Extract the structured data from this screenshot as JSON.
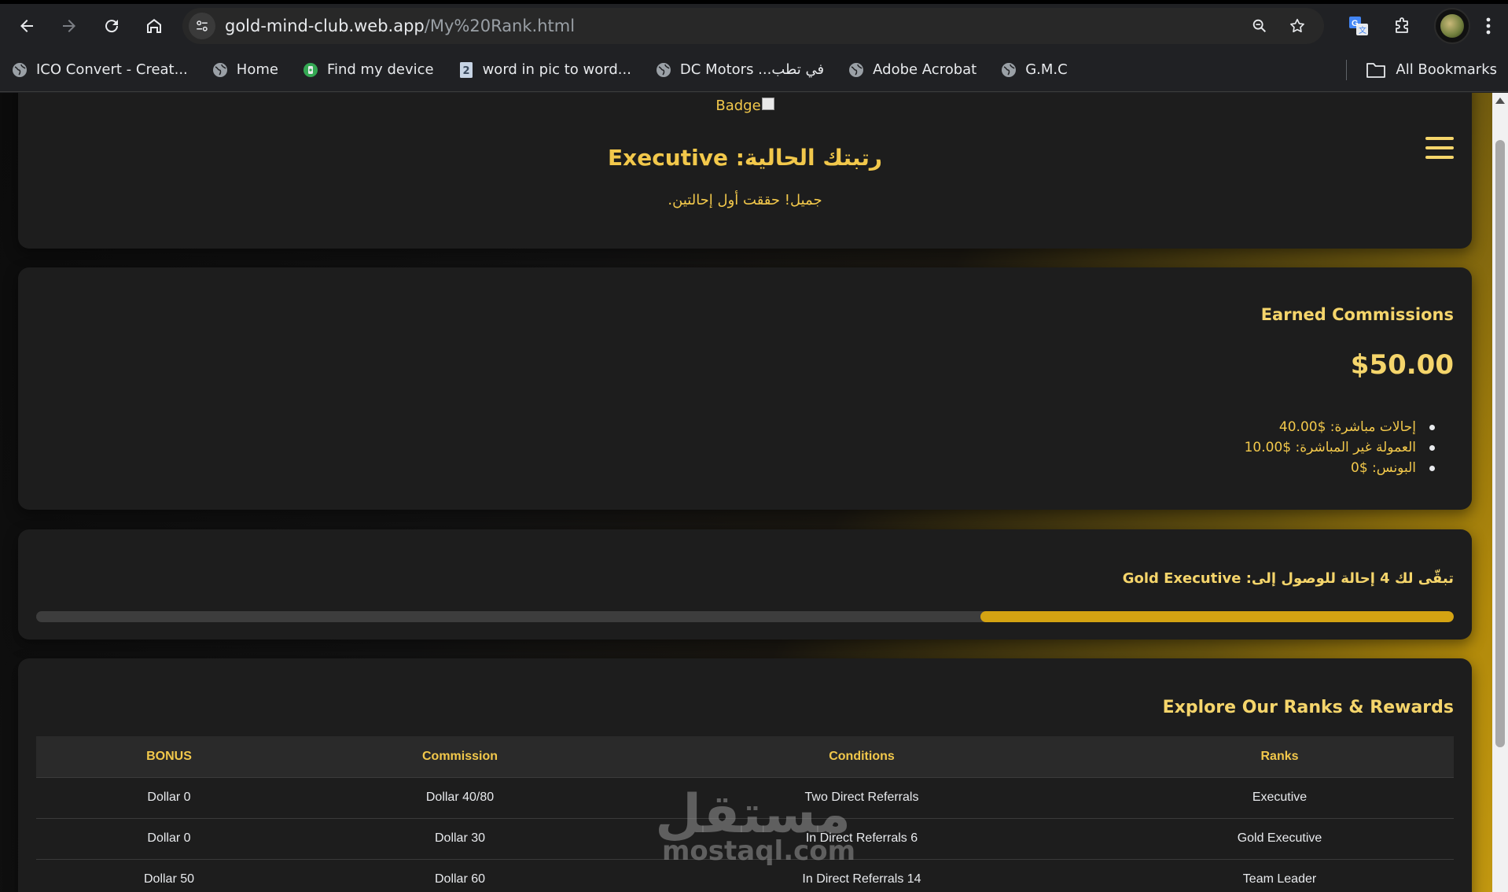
{
  "browser": {
    "url_host": "gold-mind-club.web.app",
    "url_path": "/My%20Rank.html",
    "bookmarks": [
      {
        "label": "ICO Convert - Creat..."
      },
      {
        "label": "Home"
      },
      {
        "label": "Find my device"
      },
      {
        "label": "word in pic to word..."
      },
      {
        "label": "DC Motors ...في تطب"
      },
      {
        "label": "Adobe Acrobat"
      },
      {
        "label": "G.M.C"
      }
    ],
    "all_bookmarks": "All Bookmarks"
  },
  "header": {
    "badge_alt": "Badge",
    "rank_title": "رتبتك الحالية: Executive",
    "rank_message": "جميل! حققت أول إحالتين."
  },
  "commissions": {
    "title": "Earned Commissions",
    "amount": "$50.00",
    "items": [
      "إحالات مباشرة: $40.00",
      "العمولة غير المباشرة: $10.00",
      "البونس: $0"
    ]
  },
  "progress": {
    "label": "تبقّى لك 4 إحالة للوصول إلى: Gold Executive",
    "fill_percent": 33.4
  },
  "ranks": {
    "title": "Explore Our Ranks & Rewards",
    "headers": [
      "BONUS",
      "Commission",
      "Conditions",
      "Ranks"
    ],
    "rows": [
      [
        "Dollar 0",
        "Dollar 40/80",
        "Two Direct Referrals",
        "Executive"
      ],
      [
        "Dollar 0",
        "Dollar 30",
        "In Direct Referrals 6",
        "Gold Executive"
      ],
      [
        "Dollar 50",
        "Dollar 60",
        "In Direct Referrals 14",
        "Team Leader"
      ]
    ]
  },
  "watermark": {
    "arabic": "مستقل",
    "latin": "mostaql.com"
  },
  "colors": {
    "accent_gold": "#f2c84b",
    "progress_fill": "#d4a312",
    "card_bg": "#1d1d1d"
  }
}
